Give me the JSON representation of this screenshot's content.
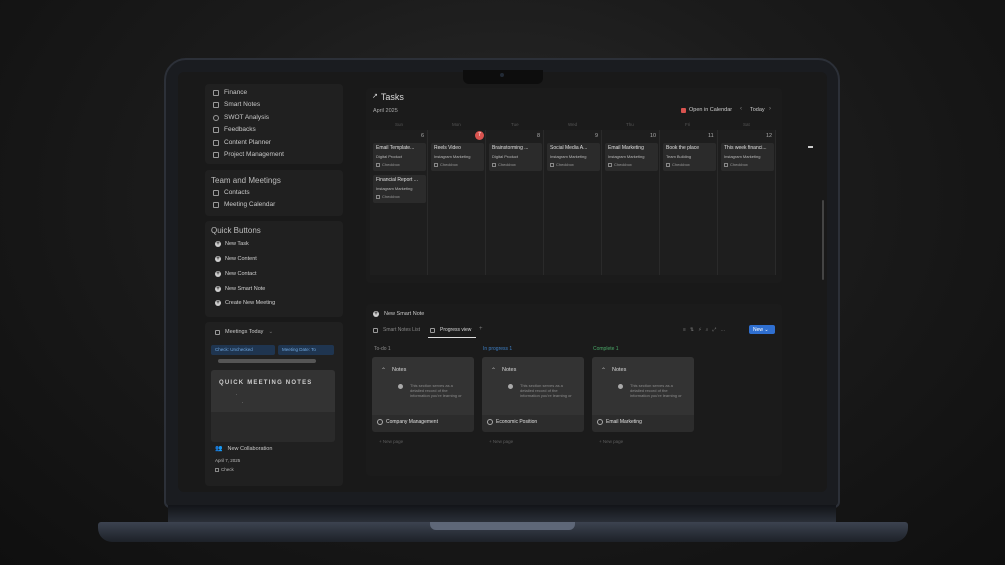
{
  "sidebar": {
    "items": [
      {
        "label": "Finance",
        "icon": "table-icon"
      },
      {
        "label": "Smart Notes",
        "icon": "edit-icon"
      },
      {
        "label": "SWOT Analysis",
        "icon": "target-icon"
      },
      {
        "label": "Feedbacks",
        "icon": "list-icon"
      },
      {
        "label": "Content Planner",
        "icon": "camera-icon"
      },
      {
        "label": "Project Management",
        "icon": "list-icon"
      }
    ],
    "team": {
      "title": "Team and Meetings",
      "items": [
        {
          "label": "Contacts",
          "icon": "people-icon"
        },
        {
          "label": "Meeting Calendar",
          "icon": "calendar-icon"
        }
      ]
    },
    "quick": {
      "title": "Quick Buttons",
      "items": [
        "New Task",
        "New Content",
        "New Contact",
        "New Smart Note",
        "Create New Meeting"
      ]
    },
    "meetings": {
      "title": "Meetings Today",
      "filter1": "Check: Unchecked",
      "filter2": "Meeting Date: To",
      "card_title": "QUICK MEETING NOTES",
      "bullet1": ".",
      "bullet2": ".",
      "item_title": "New Collaboration",
      "item_date": "April 7, 2025",
      "item_check": "Check"
    }
  },
  "tasks": {
    "title": "Tasks",
    "month": "April 2025",
    "open_calendar": "Open in Calendar",
    "today": "Today",
    "weekdays": [
      "Sun",
      "Mon",
      "Tue",
      "Wed",
      "Thu",
      "Fri",
      "Sat"
    ],
    "days": [
      "6",
      "7",
      "8",
      "9",
      "10",
      "11",
      "12"
    ],
    "events": [
      {
        "title": "Email Template...",
        "tag": "Digital Product",
        "check": "Checkbox"
      },
      {
        "title": "Reels Video",
        "tag": "Instagram Marketing",
        "check": "Checkbox"
      },
      {
        "title": "Brainstorming ...",
        "tag": "Digital Product",
        "check": "Checkbox"
      },
      {
        "title": "Social Media A...",
        "tag": "Instagram Marketing",
        "check": "Checkbox"
      },
      {
        "title": "Email Marketing",
        "tag": "Instagram Marketing",
        "check": "Checkbox"
      },
      {
        "title": "Book the place",
        "tag": "Team Building",
        "check": "Checkbox"
      },
      {
        "title": "This week financi...",
        "tag": "Instagram Marketing",
        "check": "Checkbox"
      }
    ],
    "extra_event": {
      "title": "Financial Report ...",
      "tag": "Instagram Marketing",
      "check": "Checkbox"
    }
  },
  "notes": {
    "new_button": "New Smart Note",
    "tab_list": "Smart Notes List",
    "tab_progress": "Progress view",
    "new": "New",
    "columns": [
      {
        "label": "To-do",
        "count": "1",
        "color": "#6e6e6e",
        "card_title": "Company Management"
      },
      {
        "label": "In progress",
        "count": "1",
        "color": "#2f6fb0",
        "card_title": "Economic Position"
      },
      {
        "label": "Complete",
        "count": "1",
        "color": "#3f9a5c",
        "card_title": "Email Marketing"
      }
    ],
    "card_note": "Notes",
    "card_text": "This section serves as a detailed record of the information you're learning or",
    "new_page": "New page"
  }
}
